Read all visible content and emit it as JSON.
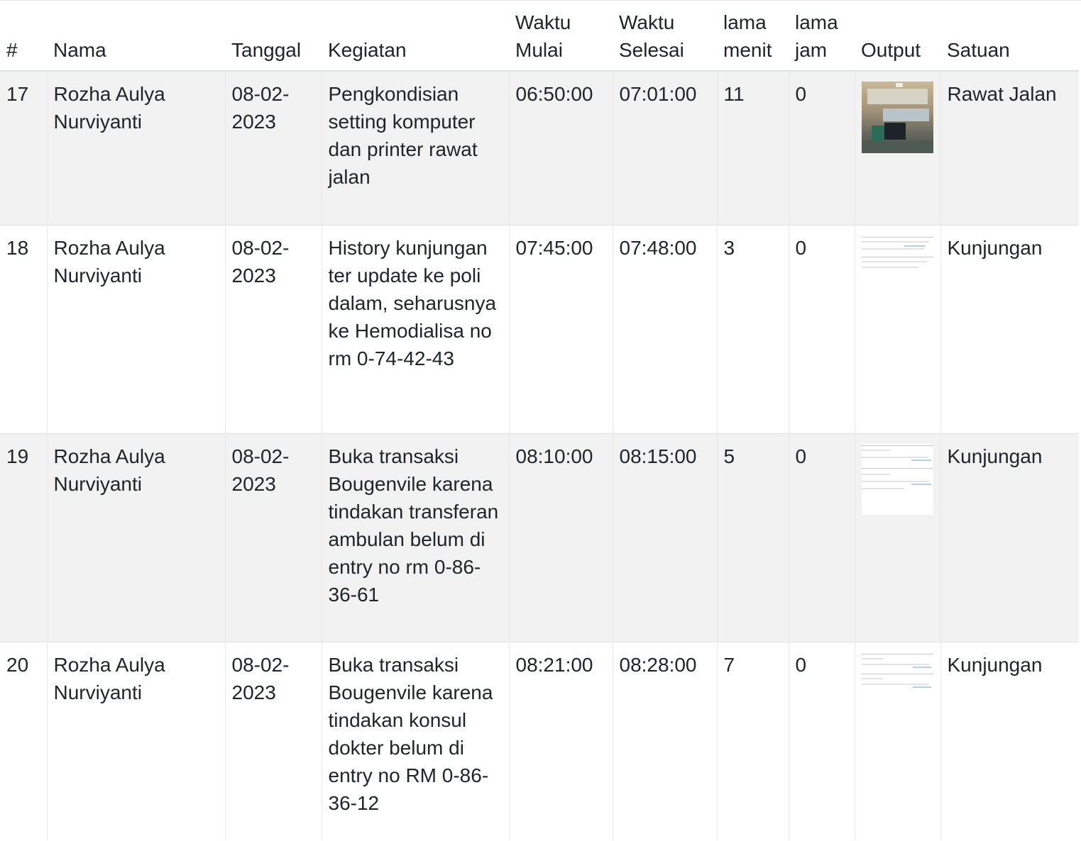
{
  "table": {
    "headers": {
      "num": "#",
      "nama": "Nama",
      "tanggal": "Tanggal",
      "kegiatan": "Kegiatan",
      "waktu_mulai": "Waktu Mulai",
      "waktu_selesai": "Waktu Selesai",
      "lama_menit": "lama menit",
      "lama_jam": "lama jam",
      "output": "Output",
      "satuan": "Satuan"
    },
    "rows": [
      {
        "num": "17",
        "nama": "Rozha Aulya Nurviyanti",
        "tanggal": "08-02-2023",
        "kegiatan": "Pengkondisian setting komputer dan printer rawat jalan",
        "waktu_mulai": "06:50:00",
        "waktu_selesai": "07:01:00",
        "lama_menit": "11",
        "lama_jam": "0",
        "output_type": "photo",
        "satuan": "Rawat Jalan"
      },
      {
        "num": "18",
        "nama": "Rozha Aulya Nurviyanti",
        "tanggal": "08-02-2023",
        "kegiatan": "History kunjungan ter update ke poli dalam, seharusnya ke Hemodialisa no rm 0-74-42-43",
        "waktu_mulai": "07:45:00",
        "waktu_selesai": "07:48:00",
        "lama_menit": "3",
        "lama_jam": "0",
        "output_type": "screenshot",
        "satuan": "Kunjungan"
      },
      {
        "num": "19",
        "nama": "Rozha Aulya Nurviyanti",
        "tanggal": "08-02-2023",
        "kegiatan": "Buka transaksi Bougenvile karena tindakan transferan ambulan belum di entry no rm 0-86-36-61",
        "waktu_mulai": "08:10:00",
        "waktu_selesai": "08:15:00",
        "lama_menit": "5",
        "lama_jam": "0",
        "output_type": "screenshot",
        "satuan": "Kunjungan"
      },
      {
        "num": "20",
        "nama": "Rozha Aulya Nurviyanti",
        "tanggal": "08-02-2023",
        "kegiatan": "Buka transaksi Bougenvile karena tindakan konsul dokter belum di entry no RM 0-86-36-12",
        "waktu_mulai": "08:21:00",
        "waktu_selesai": "08:28:00",
        "lama_menit": "7",
        "lama_jam": "0",
        "output_type": "screenshot",
        "satuan": "Kunjungan"
      }
    ]
  }
}
